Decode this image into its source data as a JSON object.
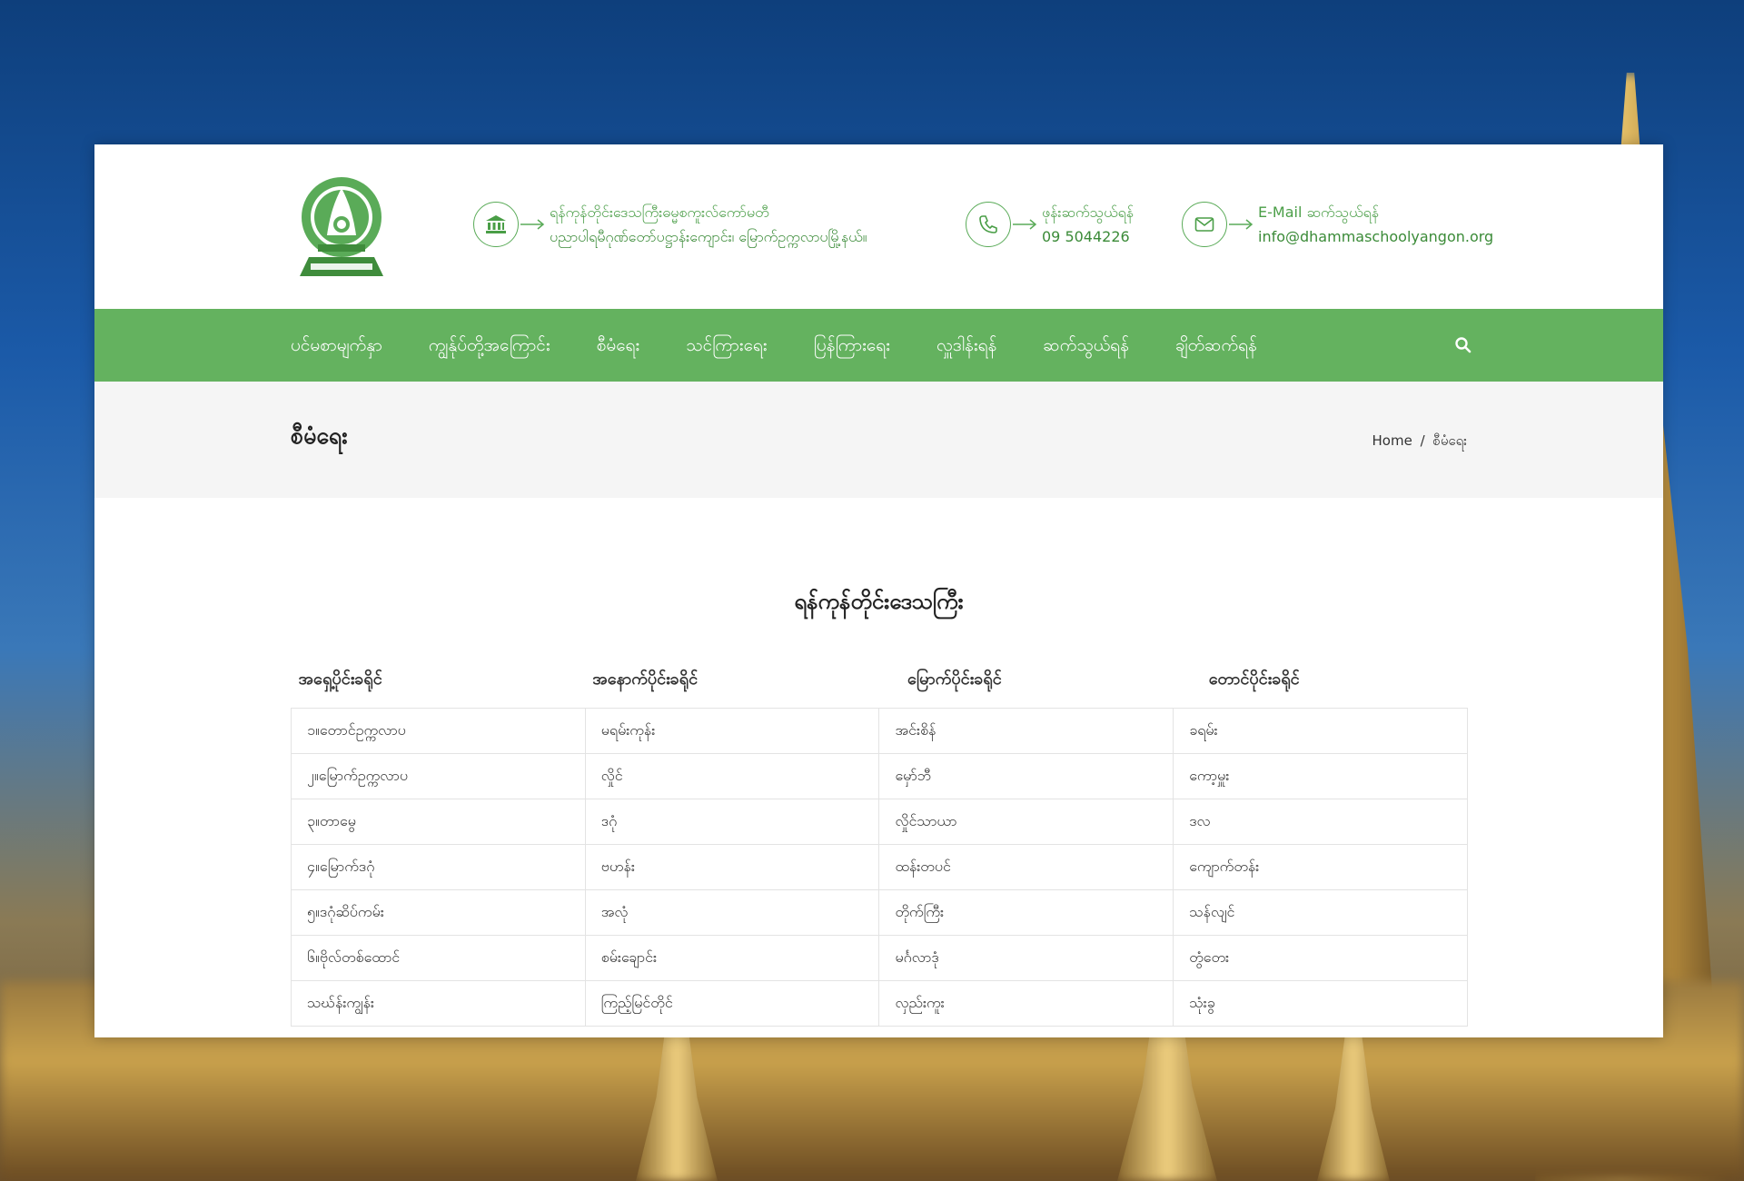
{
  "header": {
    "address": {
      "line1": "ရန်ကုန်တိုင်းဒေသကြီးဓမ္မစကူးလ်ကော်မတီ",
      "line2": "ပညာပါရမီဂုဏ်တော်ပဋ္ဌာန်းကျောင်း၊ မြောက်ဥက္ကလာပမြို့နယ်။",
      "icon": "bank-icon"
    },
    "phone": {
      "label": "ဖုန်းဆက်သွယ်ရန်",
      "value": "09 5044226",
      "icon": "phone-icon"
    },
    "email": {
      "label": "E-Mail ဆက်သွယ်ရန်",
      "value": "info@dhammaschoolyangon.org",
      "icon": "envelope-icon"
    }
  },
  "nav": {
    "items": [
      "ပင်မစာမျက်နှာ",
      "ကျွန်ုပ်တို့အကြောင်း",
      "စီမံရေး",
      "သင်ကြားရေး",
      "ပြန်ကြားရေး",
      "လှူဒါန်းရန်",
      "ဆက်သွယ်ရန်",
      "ချိတ်ဆက်ရန်"
    ],
    "search_icon": "search-icon"
  },
  "page_title": "စီမံရေး",
  "breadcrumb": {
    "home": "Home",
    "separator": "/",
    "current": "စီမံရေး"
  },
  "section_title": "ရန်ကုန်တိုင်းဒေသကြီး",
  "table": {
    "headers": [
      "အရှေ့ပိုင်းခရိုင်",
      "အနောက်ပိုင်းခရိုင်",
      "မြောက်ပိုင်းခရိုင်",
      "တောင်ပိုင်းခရိုင်"
    ],
    "rows": [
      [
        "၁။တောင်ဥက္ကလာပ",
        "မရမ်းကုန်း",
        "အင်းစိန်",
        "ခရမ်း"
      ],
      [
        "၂။မြောက်ဥက္ကလာပ",
        "လှိုင်",
        "မှော်ဘီ",
        "ကော့မှူး"
      ],
      [
        "၃။တာမွေ",
        "ဒဂုံ",
        "လှိုင်သာယာ",
        "ဒလ"
      ],
      [
        "၄။မြောက်ဒဂုံ",
        "ဗဟန်း",
        "ထန်းတပင်",
        "ကျောက်တန်း"
      ],
      [
        "၅။ဒဂုံဆိပ်ကမ်း",
        "အလုံ",
        "တိုက်ကြီး",
        "သန်လျင်"
      ],
      [
        "၆။ဗိုလ်တစ်ထောင်",
        "စမ်းချောင်း",
        "မင်္ဂလာဒုံ",
        "တွံတေး"
      ],
      [
        "သဃ်န်းကျွန်း",
        "ကြည့်မြင်တိုင်",
        "လှည်းကူး",
        "သုံးခွ"
      ]
    ]
  },
  "colors": {
    "accent": "#64b25f",
    "accent_text": "#4a9e47"
  }
}
